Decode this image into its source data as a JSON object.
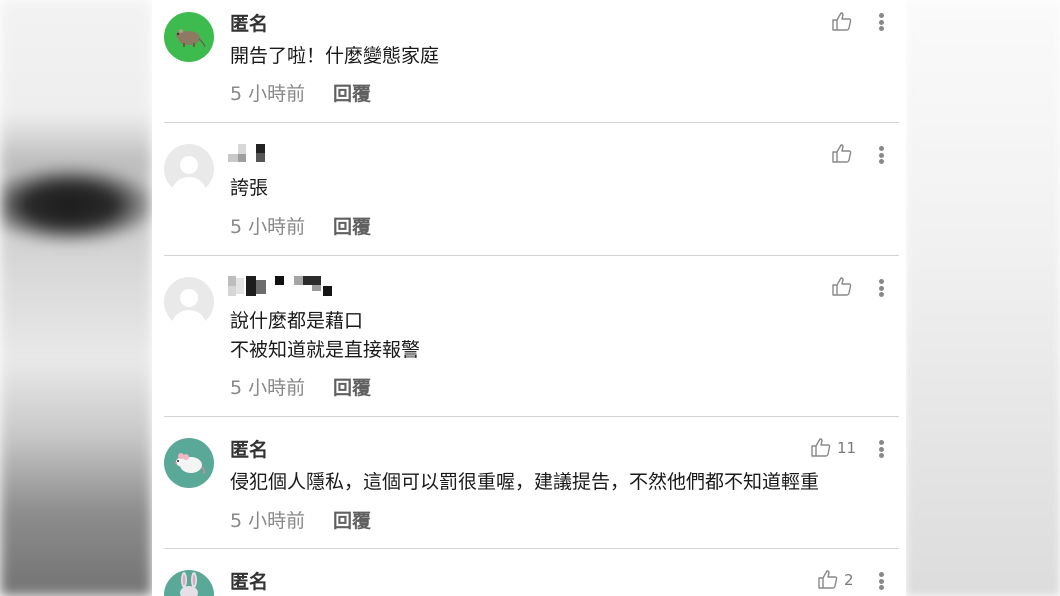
{
  "comments": [
    {
      "avatar_icon": "rat-icon",
      "name": "匿名",
      "text_lines": [
        "開告了啦！什麼變態家庭"
      ],
      "time": "5 小時前",
      "reply": "回覆",
      "likes": ""
    },
    {
      "avatar_icon": "default-user-icon",
      "name": "",
      "text_lines": [
        "誇張"
      ],
      "time": "5 小時前",
      "reply": "回覆",
      "likes": ""
    },
    {
      "avatar_icon": "default-user-icon",
      "name": "",
      "text_lines": [
        "說什麼都是藉口",
        "不被知道就是直接報警"
      ],
      "time": "5 小時前",
      "reply": "回覆",
      "likes": ""
    },
    {
      "avatar_icon": "mouse-icon",
      "name": "匿名",
      "text_lines": [
        "侵犯個人隱私，這個可以罰很重喔，建議提告，不然他們都不知道輕重"
      ],
      "time": "5 小時前",
      "reply": "回覆",
      "likes": "11"
    },
    {
      "avatar_icon": "rabbit-icon",
      "name": "匿名",
      "text_lines": [],
      "time": "",
      "reply": "",
      "likes": "2"
    }
  ],
  "colors": {
    "avatar_green": "#3dbb4f",
    "avatar_teal": "#5aa898",
    "avatar_gray": "#e9e9e9",
    "divider": "#d2d2d2",
    "meta_text": "#888888"
  },
  "icons": {
    "like": "thumbs-up-icon",
    "more": "more-vertical-icon"
  }
}
